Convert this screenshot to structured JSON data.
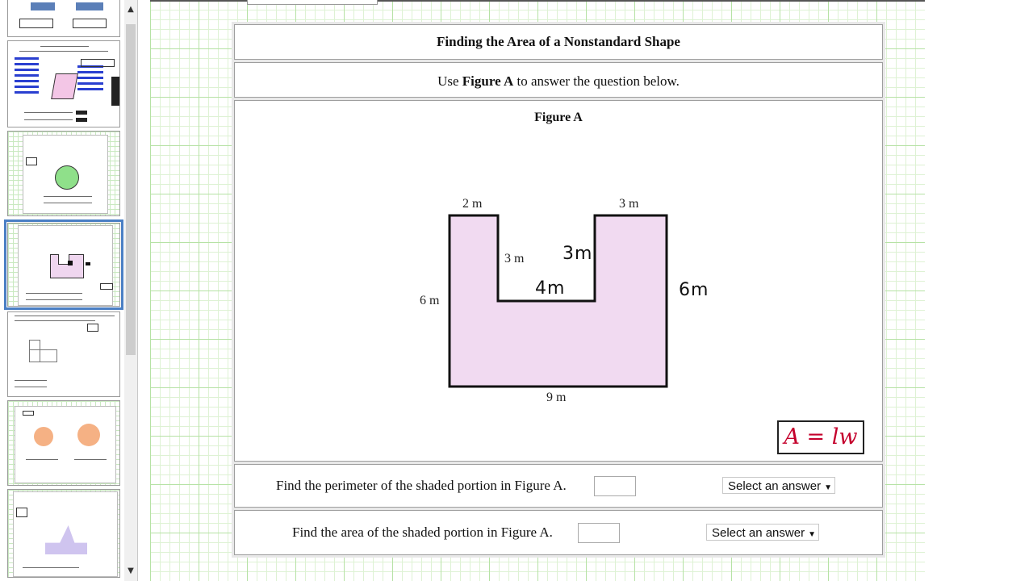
{
  "slide": {
    "title": "Finding the Area of a Nonstandard Shape",
    "instruction_prefix": "Use",
    "instruction_figure": "Figure A",
    "instruction_suffix": "to answer the question below.",
    "figure_title": "Figure A",
    "figure": {
      "fill_color": "#f1daf1",
      "outline_color": "#111111",
      "labels": {
        "top_left": "2 m",
        "top_right": "3 m",
        "inner_left": "3 m",
        "left": "6 m",
        "bottom": "9 m"
      },
      "handwritten": {
        "inner_right": "3m",
        "notch_bottom": "4m",
        "right": "6m"
      }
    },
    "formula": "A = lw",
    "formula_color": "#c4002c",
    "questions": [
      {
        "text": "Find the perimeter of the shaded portion in Figure A.",
        "answer": "",
        "unit_select": "Select an answer"
      },
      {
        "text": "Find the area of the shaded portion in Figure A.",
        "answer": "",
        "unit_select": "Select an answer"
      }
    ]
  },
  "sidebar": {
    "selected_index": 3,
    "scroll_up_icon": "chevron-up-icon",
    "scroll_down_icon": "chevron-down-icon",
    "scroll_up_glyph": "▲",
    "scroll_down_glyph": "▼"
  }
}
